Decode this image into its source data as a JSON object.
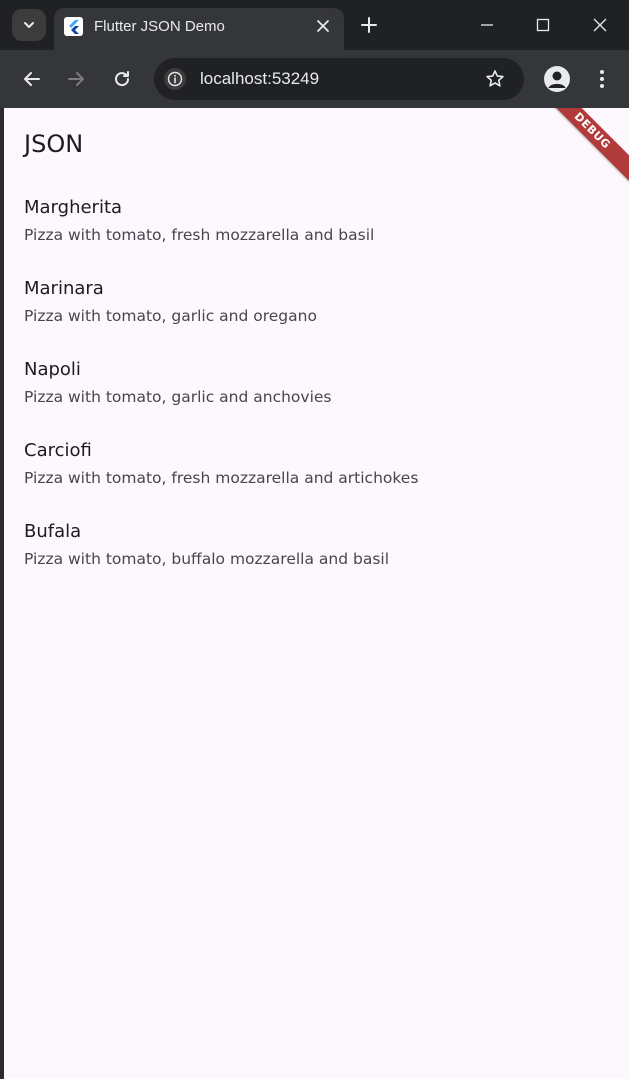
{
  "browser": {
    "tab_title": "Flutter JSON Demo",
    "url": "localhost:53249",
    "icons": {
      "tab_search": "chevron-down-icon",
      "favicon": "flutter-icon",
      "tab_close": "close-icon",
      "new_tab": "plus-icon",
      "minimize": "minimize-icon",
      "maximize": "maximize-icon",
      "close_window": "close-icon",
      "back": "arrow-left-icon",
      "forward": "arrow-right-icon",
      "reload": "reload-icon",
      "site_info": "info-icon",
      "bookmark": "star-icon",
      "profile": "avatar-icon",
      "menu": "kebab-menu-icon"
    }
  },
  "app": {
    "title": "JSON",
    "debug_banner": "DEBUG",
    "items": [
      {
        "name": "Margherita",
        "description": "Pizza with tomato, fresh mozzarella and basil"
      },
      {
        "name": "Marinara",
        "description": "Pizza with tomato, garlic and oregano"
      },
      {
        "name": "Napoli",
        "description": "Pizza with tomato, garlic and anchovies"
      },
      {
        "name": "Carciofi",
        "description": "Pizza with tomato, fresh mozzarella and artichokes"
      },
      {
        "name": "Bufala",
        "description": "Pizza with tomato, buffalo mozzarella and basil"
      }
    ]
  },
  "colors": {
    "page_background": "#fdf7fe",
    "debug_banner": "#b13b3b",
    "browser_frame": "#202124",
    "toolbar": "#35363a"
  }
}
